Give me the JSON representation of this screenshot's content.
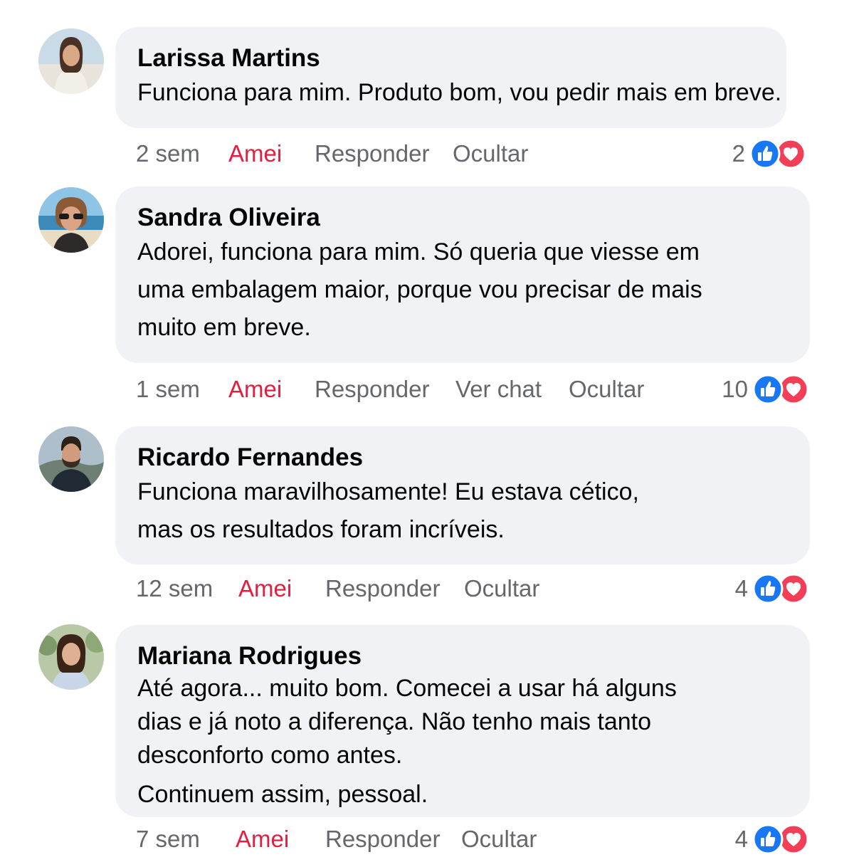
{
  "comments": [
    {
      "author": "Larissa Martins",
      "lines": [
        "Funciona para mim. Produto bom, vou pedir mais em breve."
      ],
      "time": "2 sem",
      "love": "Amei",
      "reply": "Responder",
      "hide": "Ocultar",
      "reactions": "2"
    },
    {
      "author": "Sandra Oliveira",
      "lines": [
        "Adorei, funciona para mim. Só queria que viesse em",
        "uma embalagem maior, porque vou precisar de mais",
        "muito em breve."
      ],
      "time": "1 sem",
      "love": "Amei",
      "reply": "Responder",
      "chat": "Ver chat",
      "hide": "Ocultar",
      "reactions": "10"
    },
    {
      "author": "Ricardo Fernandes",
      "lines": [
        "Funciona maravilhosamente! Eu estava cético,",
        "mas os resultados foram incríveis."
      ],
      "time": "12 sem",
      "love": "Amei",
      "reply": "Responder",
      "hide": "Ocultar",
      "reactions": "4"
    },
    {
      "author": "Mariana Rodrigues",
      "lines": [
        "Até agora... muito bom. Comecei a usar há alguns",
        "dias e já noto a diferença. Não tenho mais tanto",
        "desconforto como antes.",
        "Continuem assim, pessoal."
      ],
      "time": "7 sem",
      "love": "Amei",
      "reply": "Responder",
      "hide": "Ocultar",
      "reactions": "4"
    }
  ],
  "icons": {
    "like": "like-icon",
    "heart": "heart-icon"
  },
  "colors": {
    "like": "#1877f2",
    "heart": "#f33e58",
    "love_text": "#e41e3f",
    "muted": "#65676b",
    "bubble": "#f0f2f5"
  }
}
